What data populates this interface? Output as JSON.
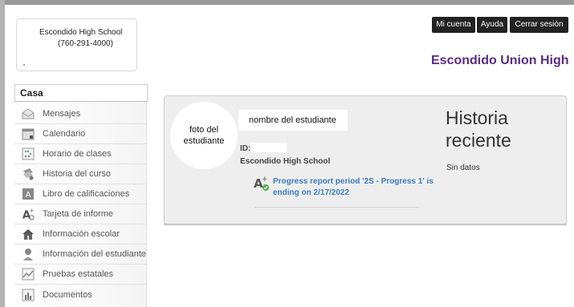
{
  "school": {
    "name": "Escondido High School",
    "phone": "(760-291-4000)"
  },
  "header": {
    "district": "Escondido Union High",
    "buttons": {
      "account": "Mi cuenta",
      "help": "Ayuda",
      "logout": "Cerrar sesión"
    }
  },
  "sidebar": {
    "section": "Casa",
    "items": [
      {
        "label": "Mensajes",
        "icon": "messages-icon"
      },
      {
        "label": "Calendario",
        "icon": "calendar-icon"
      },
      {
        "label": "Horario de clases",
        "icon": "schedule-icon"
      },
      {
        "label": "Historia del curso",
        "icon": "course-history-icon"
      },
      {
        "label": "Libro de calificaciones",
        "icon": "gradebook-icon"
      },
      {
        "label": "Tarjeta de informe",
        "icon": "report-card-icon"
      },
      {
        "label": "Información escolar",
        "icon": "school-info-icon"
      },
      {
        "label": "Información del estudiante",
        "icon": "student-info-icon"
      },
      {
        "label": "Pruebas estatales",
        "icon": "state-tests-icon"
      },
      {
        "label": "Documentos",
        "icon": "documents-icon"
      }
    ]
  },
  "student": {
    "photo_label": "foto del estudiante",
    "name_label": "nombre del estudiante",
    "id_label": "ID:",
    "school": "Escondido High School",
    "notice": "Progress report period '2S - Progress 1' is ending on 2/17/2022"
  },
  "history": {
    "title": "Historia reciente",
    "empty": "Sin datos"
  },
  "colors": {
    "brand": "#5b2c86",
    "link": "#3b7cc4",
    "topbar_button": "#222222",
    "badge_green": "#4caf50"
  }
}
